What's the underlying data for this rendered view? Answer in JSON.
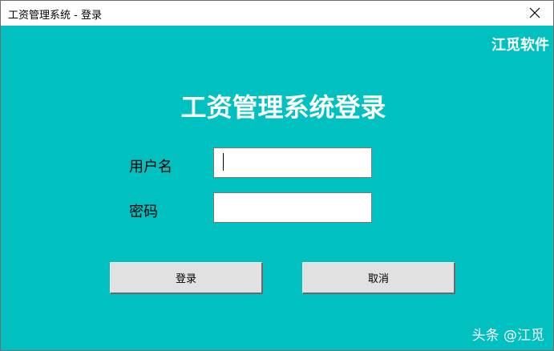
{
  "window": {
    "title": "工资管理系统 - 登录"
  },
  "brand": "江觅软件",
  "heading": "工资管理系统登录",
  "form": {
    "username_label": "用户名",
    "username_value": "",
    "password_label": "密码",
    "password_value": ""
  },
  "buttons": {
    "login_label": "登录",
    "cancel_label": "取消"
  },
  "watermark": "头条 @江觅",
  "colors": {
    "background": "#00c0c0",
    "text_light": "#ffffff",
    "button_face": "#e1e1e1"
  }
}
